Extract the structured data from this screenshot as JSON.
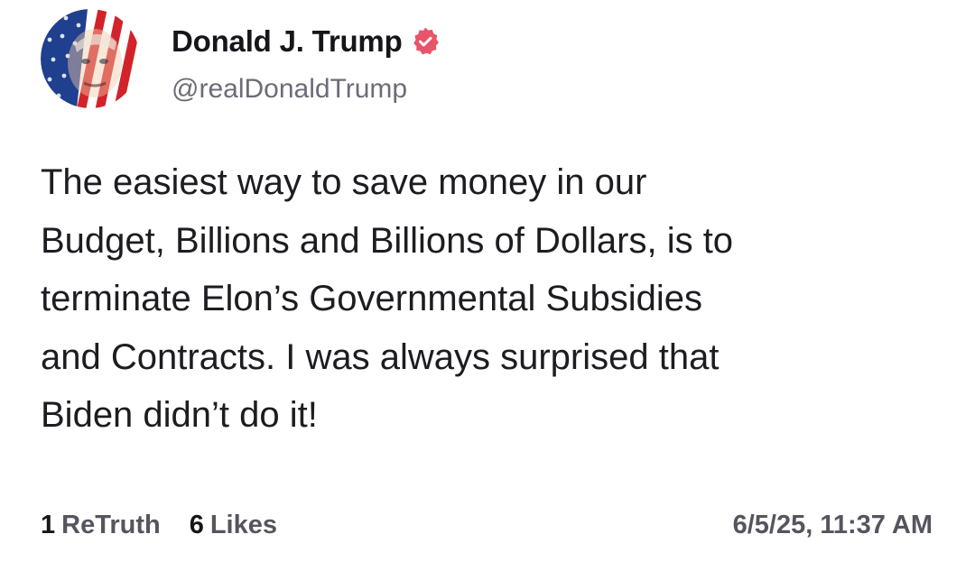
{
  "author": {
    "display_name": "Donald J. Trump",
    "handle": "@realDonaldTrump",
    "verified_badge_icon": "verified-badge-icon",
    "avatar_icon": "profile-avatar"
  },
  "post": {
    "lines": [
      "The easiest way to save money in our",
      "Budget, Billions and Billions of Dollars, is to",
      "terminate Elon’s Governmental Subsidies",
      "and Contracts. I was always surprised that",
      "Biden didn’t do it!"
    ]
  },
  "stats": {
    "retruths_count": "1",
    "retruths_label": "ReTruth",
    "likes_count": "6",
    "likes_label": "Likes"
  },
  "timestamp": "6/5/25, 11:37 AM",
  "colors": {
    "background": "#ffffff",
    "text_primary": "#16161a",
    "text_secondary": "#55555f",
    "handle": "#6c6c78",
    "verified_badge": "#e8546a"
  }
}
